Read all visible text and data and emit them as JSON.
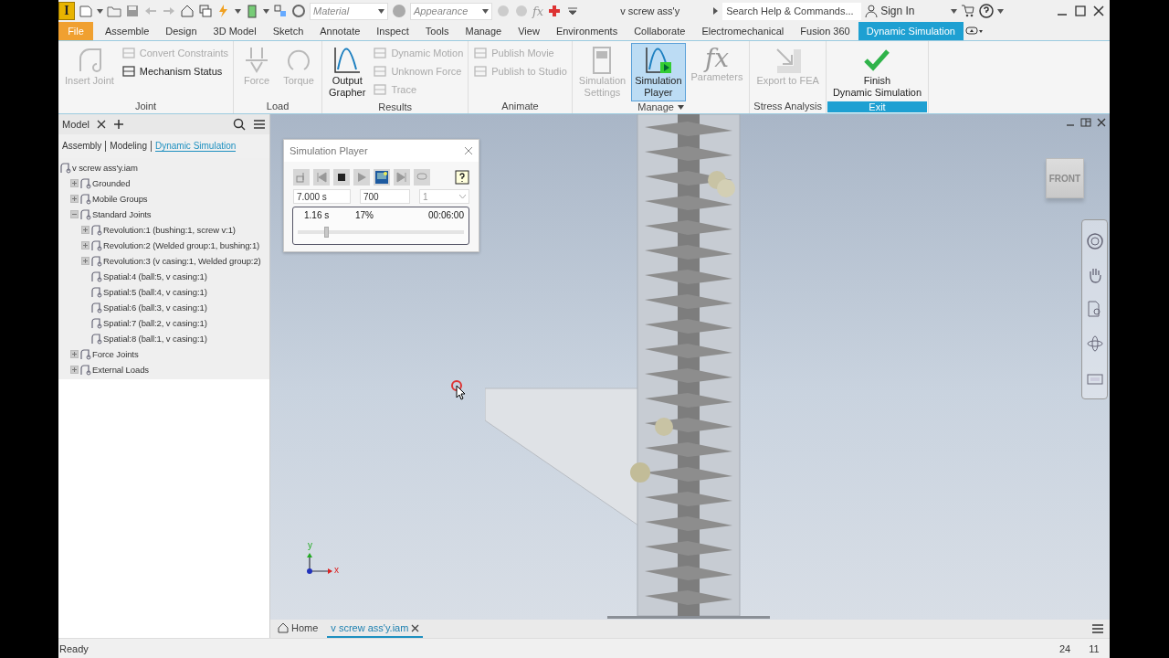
{
  "title_bar": {
    "app_logo": "I",
    "material": {
      "placeholder": "Material"
    },
    "appearance": {
      "placeholder": "Appearance"
    },
    "formula_glyph": "fx",
    "document_title": "v screw ass'y",
    "search": {
      "placeholder": "Search Help & Commands..."
    },
    "sign_in": "Sign In"
  },
  "ribbon_tabs": [
    {
      "label": "File",
      "kind": "file",
      "selected": false
    },
    {
      "label": "Assemble",
      "kind": "tab",
      "selected": false
    },
    {
      "label": "Design",
      "kind": "tab",
      "selected": false
    },
    {
      "label": "3D Model",
      "kind": "tab",
      "selected": false
    },
    {
      "label": "Sketch",
      "kind": "tab",
      "selected": false
    },
    {
      "label": "Annotate",
      "kind": "tab",
      "selected": false
    },
    {
      "label": "Inspect",
      "kind": "tab",
      "selected": false
    },
    {
      "label": "Tools",
      "kind": "tab",
      "selected": false
    },
    {
      "label": "Manage",
      "kind": "tab",
      "selected": false
    },
    {
      "label": "View",
      "kind": "tab",
      "selected": false
    },
    {
      "label": "Environments",
      "kind": "tab",
      "selected": false
    },
    {
      "label": "Collaborate",
      "kind": "tab",
      "selected": false
    },
    {
      "label": "Electromechanical",
      "kind": "tab",
      "selected": false
    },
    {
      "label": "Fusion 360",
      "kind": "tab",
      "selected": false
    },
    {
      "label": "Dynamic Simulation",
      "kind": "tab",
      "selected": true
    }
  ],
  "ribbon_panels": [
    {
      "title": "Joint",
      "has_menu": false,
      "highlight": false,
      "buttons": [
        {
          "label": "Insert Joint",
          "kind": "large",
          "disabled": true,
          "selected": false
        },
        {
          "label": "Convert Constraints",
          "kind": "small",
          "disabled": true
        },
        {
          "label": "Mechanism Status",
          "kind": "small",
          "disabled": false
        }
      ]
    },
    {
      "title": "Load",
      "has_menu": false,
      "highlight": false,
      "buttons": [
        {
          "label": "Force",
          "kind": "large",
          "disabled": true,
          "selected": false
        },
        {
          "label": "Torque",
          "kind": "large",
          "disabled": true,
          "selected": false
        }
      ]
    },
    {
      "title": "Results",
      "has_menu": false,
      "highlight": false,
      "buttons": [
        {
          "label": "Output\nGrapher",
          "kind": "large",
          "disabled": false,
          "selected": false
        },
        {
          "label": "Dynamic Motion",
          "kind": "small",
          "disabled": true
        },
        {
          "label": "Unknown Force",
          "kind": "small",
          "disabled": true
        },
        {
          "label": "Trace",
          "kind": "small",
          "disabled": true
        }
      ]
    },
    {
      "title": "Animate",
      "has_menu": false,
      "highlight": false,
      "buttons": [
        {
          "label": "Publish Movie",
          "kind": "small",
          "disabled": true
        },
        {
          "label": "Publish to Studio",
          "kind": "small",
          "disabled": true
        }
      ]
    },
    {
      "title": "Manage",
      "has_menu": true,
      "highlight": false,
      "buttons": [
        {
          "label": "Simulation\nSettings",
          "kind": "large",
          "disabled": true,
          "selected": false
        },
        {
          "label": "Simulation\nPlayer",
          "kind": "large",
          "disabled": false,
          "selected": true
        },
        {
          "label": "Parameters",
          "kind": "large",
          "disabled": true,
          "selected": false,
          "glyph": "fx"
        }
      ]
    },
    {
      "title": "Stress Analysis",
      "has_menu": false,
      "highlight": false,
      "buttons": [
        {
          "label": "Export to FEA",
          "kind": "large",
          "disabled": true,
          "selected": false
        }
      ]
    },
    {
      "title": "Exit",
      "has_menu": false,
      "highlight": true,
      "buttons": [
        {
          "label": "Finish\nDynamic Simulation",
          "kind": "large",
          "disabled": false,
          "selected": false
        }
      ]
    }
  ],
  "browser": {
    "tab": "Model",
    "modes": [
      {
        "label": "Assembly",
        "selected": false
      },
      {
        "label": "Modeling",
        "selected": false
      },
      {
        "label": "Dynamic Simulation",
        "selected": true
      }
    ],
    "tree": [
      {
        "label": "v screw ass'y.iam",
        "children": [
          {
            "label": "Grounded",
            "expanded": false
          },
          {
            "label": "Mobile Groups",
            "expanded": false
          },
          {
            "label": "Standard Joints",
            "expanded": true,
            "children": [
              {
                "label": "Revolution:1 (bushing:1, screw v:1)",
                "expanded": false
              },
              {
                "label": "Revolution:2 (Welded group:1, bushing:1)",
                "expanded": false
              },
              {
                "label": "Revolution:3 (v casing:1, Welded group:2)",
                "expanded": false
              },
              {
                "label": "Spatial:4 (ball:5, v casing:1)"
              },
              {
                "label": "Spatial:5 (ball:4, v casing:1)"
              },
              {
                "label": "Spatial:6 (ball:3, v casing:1)"
              },
              {
                "label": "Spatial:7 (ball:2, v casing:1)"
              },
              {
                "label": "Spatial:8 (ball:1, v casing:1)"
              }
            ]
          },
          {
            "label": "Force Joints",
            "expanded": false
          },
          {
            "label": "External Loads",
            "expanded": false
          }
        ]
      }
    ]
  },
  "simulation_player": {
    "title": "Simulation Player",
    "end_time": "7.000 s",
    "steps": "700",
    "speed": "1",
    "current_time": "1.16 s",
    "percent": "17%",
    "elapsed": "00:06:00",
    "level": 0.17
  },
  "viewcube": {
    "face": "FRONT"
  },
  "axis_labels": {
    "y": "y",
    "x": "x"
  },
  "document_tabs": [
    {
      "label": "Home",
      "kind": "home",
      "selected": false
    },
    {
      "label": "v screw ass'y.iam",
      "kind": "document",
      "selected": true
    }
  ],
  "status_bar": {
    "message": "Ready",
    "column_1": "24",
    "column_2": "11"
  }
}
